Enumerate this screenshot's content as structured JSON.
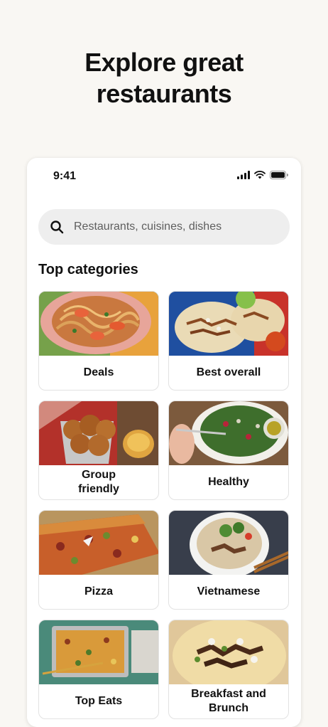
{
  "hero": {
    "line1": "Explore great",
    "line2": "restaurants"
  },
  "status_bar": {
    "time": "9:41"
  },
  "search": {
    "placeholder": "Restaurants, cuisines, dishes"
  },
  "section": {
    "title": "Top categories"
  },
  "categories": [
    {
      "label": "Deals",
      "icon": "shrimp-noodles"
    },
    {
      "label": "Best overall",
      "icon": "tacos"
    },
    {
      "label": "Group\nfriendly",
      "icon": "fried-chicken"
    },
    {
      "label": "Healthy",
      "icon": "salad-bowl"
    },
    {
      "label": "Pizza",
      "icon": "pizza"
    },
    {
      "label": "Vietnamese",
      "icon": "pho-bowl"
    },
    {
      "label": "Top Eats",
      "icon": "rice-tray"
    },
    {
      "label": "Breakfast and\nBrunch",
      "icon": "breakfast-taco"
    }
  ],
  "colors": {
    "background": "#f9f7f3",
    "card_border": "#e2e2e2",
    "search_bg": "#eeeeee"
  }
}
